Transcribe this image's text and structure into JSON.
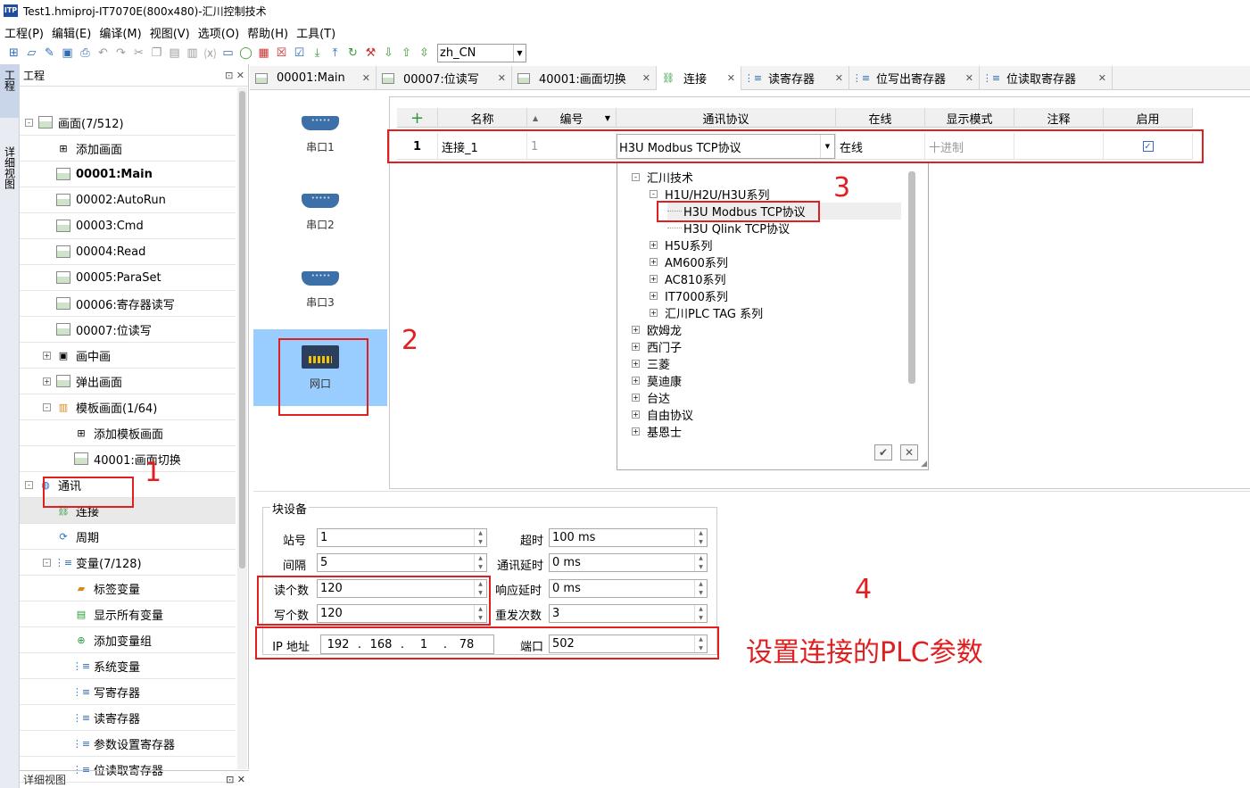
{
  "window": {
    "title": "Test1.hmiproj-IT7070E(800x480)-汇川控制技术",
    "app_badge": "ITP"
  },
  "menu": [
    "工程(P)",
    "编辑(E)",
    "编译(M)",
    "视图(V)",
    "选项(O)",
    "帮助(H)",
    "工具(T)"
  ],
  "toolbar": {
    "language": "zh_CN"
  },
  "side_tabs": {
    "project": "工程",
    "detail": "详细视图"
  },
  "project_panel": {
    "title": "工程",
    "tree": [
      {
        "label": "画面(7/512)",
        "level": 0,
        "expander": "-",
        "icon": "screen-folder-icon"
      },
      {
        "label": "添加画面",
        "level": 1,
        "icon": "add-icon"
      },
      {
        "label": "00001:Main",
        "level": 1,
        "icon": "screen-icon",
        "bold": true
      },
      {
        "label": "00002:AutoRun",
        "level": 1,
        "icon": "screen-icon"
      },
      {
        "label": "00003:Cmd",
        "level": 1,
        "icon": "screen-icon"
      },
      {
        "label": "00004:Read",
        "level": 1,
        "icon": "screen-icon"
      },
      {
        "label": "00005:ParaSet",
        "level": 1,
        "icon": "screen-icon"
      },
      {
        "label": "00006:寄存器读写",
        "level": 1,
        "icon": "screen-icon"
      },
      {
        "label": "00007:位读写",
        "level": 1,
        "icon": "screen-icon"
      },
      {
        "label": "画中画",
        "level": 1,
        "expander": "+",
        "icon": "pip-icon"
      },
      {
        "label": "弹出画面",
        "level": 1,
        "expander": "+",
        "icon": "popup-icon"
      },
      {
        "label": "模板画面(1/64)",
        "level": 1,
        "expander": "-",
        "icon": "template-icon"
      },
      {
        "label": "添加模板画面",
        "level": 2,
        "icon": "add-icon"
      },
      {
        "label": "40001:画面切换",
        "level": 2,
        "icon": "screen-icon"
      },
      {
        "label": "通讯",
        "level": 0,
        "expander": "-",
        "icon": "globe-icon"
      },
      {
        "label": "连接",
        "level": 1,
        "icon": "connection-icon",
        "selected": true
      },
      {
        "label": "周期",
        "level": 1,
        "icon": "cycle-icon"
      },
      {
        "label": "变量(7/128)",
        "level": 1,
        "expander": "-",
        "icon": "variable-icon"
      },
      {
        "label": "标签变量",
        "level": 2,
        "icon": "tag-folder-icon"
      },
      {
        "label": "显示所有变量",
        "level": 2,
        "icon": "show-all-icon"
      },
      {
        "label": "添加变量组",
        "level": 2,
        "icon": "add-group-icon"
      },
      {
        "label": "系统变量",
        "level": 2,
        "icon": "variable-icon"
      },
      {
        "label": "写寄存器",
        "level": 2,
        "icon": "variable-icon"
      },
      {
        "label": "读寄存器",
        "level": 2,
        "icon": "variable-icon"
      },
      {
        "label": "参数设置寄存器",
        "level": 2,
        "icon": "variable-icon"
      },
      {
        "label": "位读取寄存器",
        "level": 2,
        "icon": "variable-icon"
      }
    ],
    "footer": "详细视图"
  },
  "tabs": [
    {
      "label": "00001:Main",
      "icon": "screen-icon"
    },
    {
      "label": "00007:位读写",
      "icon": "screen-icon"
    },
    {
      "label": "40001:画面切换",
      "icon": "screen-icon"
    },
    {
      "label": "连接",
      "icon": "connection-icon",
      "active": true
    },
    {
      "label": "读寄存器",
      "icon": "variable-icon"
    },
    {
      "label": "位写出寄存器",
      "icon": "variable-icon"
    },
    {
      "label": "位读取寄存器",
      "icon": "variable-icon"
    }
  ],
  "ports": [
    {
      "label": "串口1"
    },
    {
      "label": "串口2"
    },
    {
      "label": "串口3"
    },
    {
      "label": "网口",
      "active": true
    }
  ],
  "conn_table": {
    "add": "+",
    "headers": [
      "名称",
      "编号",
      "通讯协议",
      "在线",
      "显示模式",
      "注释",
      "启用"
    ],
    "row": {
      "index": "1",
      "name": "连接_1",
      "number": "1",
      "protocol": "H3U Modbus TCP协议",
      "online": "在线",
      "display_mode": "十进制",
      "comment": "",
      "enabled": true
    }
  },
  "protocol_tree": [
    {
      "label": "汇川技术",
      "level": 0,
      "expander": "-"
    },
    {
      "label": "H1U/H2U/H3U系列",
      "level": 1,
      "expander": "-"
    },
    {
      "label": "H3U Modbus TCP协议",
      "level": 2,
      "selected": true
    },
    {
      "label": "H3U Qlink TCP协议",
      "level": 2
    },
    {
      "label": "H5U系列",
      "level": 1,
      "expander": "+"
    },
    {
      "label": "AM600系列",
      "level": 1,
      "expander": "+"
    },
    {
      "label": "AC810系列",
      "level": 1,
      "expander": "+"
    },
    {
      "label": "IT7000系列",
      "level": 1,
      "expander": "+"
    },
    {
      "label": "汇川PLC TAG 系列",
      "level": 1,
      "expander": "+"
    },
    {
      "label": "欧姆龙",
      "level": 0,
      "expander": "+"
    },
    {
      "label": "西门子",
      "level": 0,
      "expander": "+"
    },
    {
      "label": "三菱",
      "level": 0,
      "expander": "+"
    },
    {
      "label": "莫迪康",
      "level": 0,
      "expander": "+"
    },
    {
      "label": "台达",
      "level": 0,
      "expander": "+"
    },
    {
      "label": "自由协议",
      "level": 0,
      "expander": "+"
    },
    {
      "label": "基恩士",
      "level": 0,
      "expander": "+"
    }
  ],
  "block_settings": {
    "legend": "块设备",
    "station_label": "站号",
    "station": "1",
    "interval_label": "间隔",
    "interval": "5",
    "read_count_label": "读个数",
    "read_count": "120",
    "write_count_label": "写个数",
    "write_count": "120",
    "timeout_label": "超时",
    "timeout": "100 ms",
    "comm_delay_label": "通讯延时",
    "comm_delay": "0 ms",
    "resp_delay_label": "响应延时",
    "resp_delay": "0 ms",
    "retry_label": "重发次数",
    "retry": "3",
    "ip_label": "IP 地址",
    "ip": [
      "192",
      "168",
      "1",
      "78"
    ],
    "port_label": "端口",
    "port": "502"
  },
  "annotations": {
    "n1": "1",
    "n2": "2",
    "n3": "3",
    "n4": "4",
    "caption": "设置连接的PLC参数",
    "color": "#e02020"
  }
}
